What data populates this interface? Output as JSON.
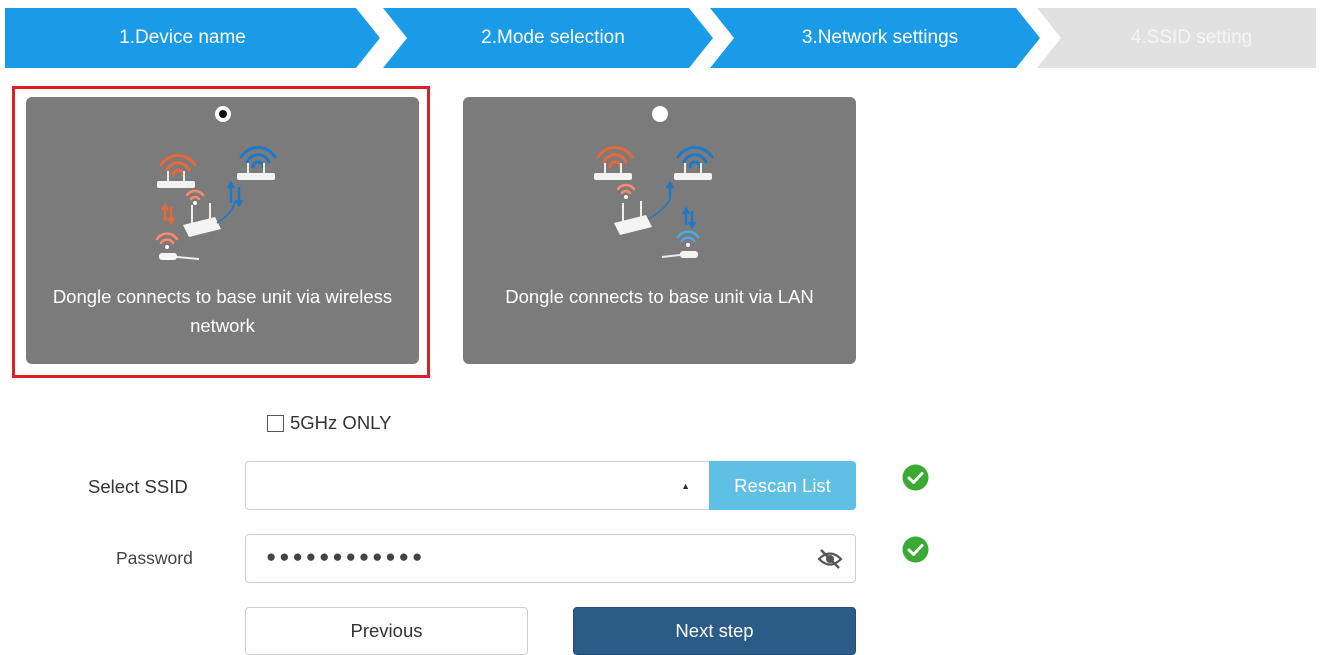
{
  "stepper": {
    "steps": [
      {
        "label": "1.Device name"
      },
      {
        "label": "2.Mode selection"
      },
      {
        "label": "3.Network settings"
      },
      {
        "label": "4.SSID setting"
      }
    ],
    "active_color": "#1a9be8",
    "inactive_color": "#e1e1e1"
  },
  "modes": [
    {
      "label": "Dongle connects to base unit via wireless network",
      "selected": true
    },
    {
      "label": "Dongle connects to base unit via LAN",
      "selected": false
    }
  ],
  "options": {
    "five_ghz_label": "5GHz ONLY",
    "five_ghz_checked": false
  },
  "form": {
    "ssid_label": "Select SSID",
    "ssid_value": "",
    "rescan_label": "Rescan List",
    "password_label": "Password",
    "password_value": "●●●●●●●●●●●●"
  },
  "buttons": {
    "previous": "Previous",
    "next": "Next step"
  },
  "colors": {
    "highlight": "#dc1f26",
    "card_bg": "#7b7b7b",
    "rescan": "#5fc0e3",
    "next": "#2b5c88",
    "ok": "#3aaa35"
  },
  "icons": [
    "wifi-router-icon",
    "eye-slash-icon",
    "check-circle-icon",
    "caret-up-icon"
  ]
}
